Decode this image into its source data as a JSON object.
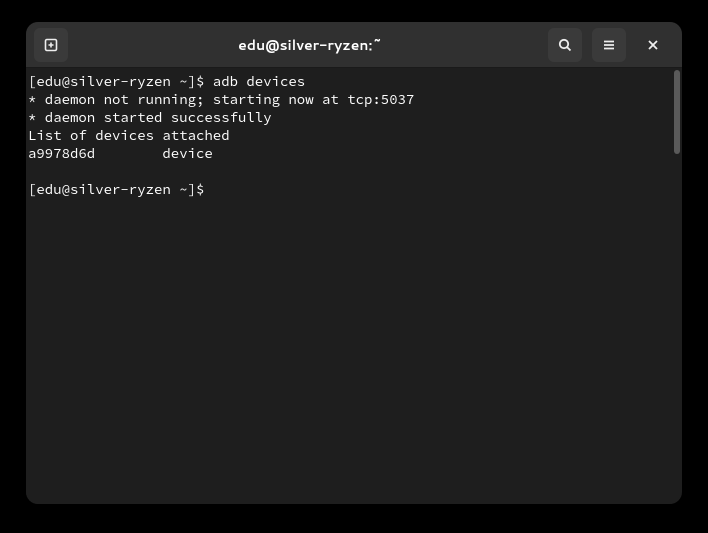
{
  "window": {
    "title": "edu@silver-ryzen:~"
  },
  "terminal": {
    "lines": [
      "[edu@silver-ryzen ~]$ adb devices",
      "* daemon not running; starting now at tcp:5037",
      "* daemon started successfully",
      "List of devices attached",
      "a9978d6d        device",
      "",
      "[edu@silver-ryzen ~]$ "
    ]
  }
}
